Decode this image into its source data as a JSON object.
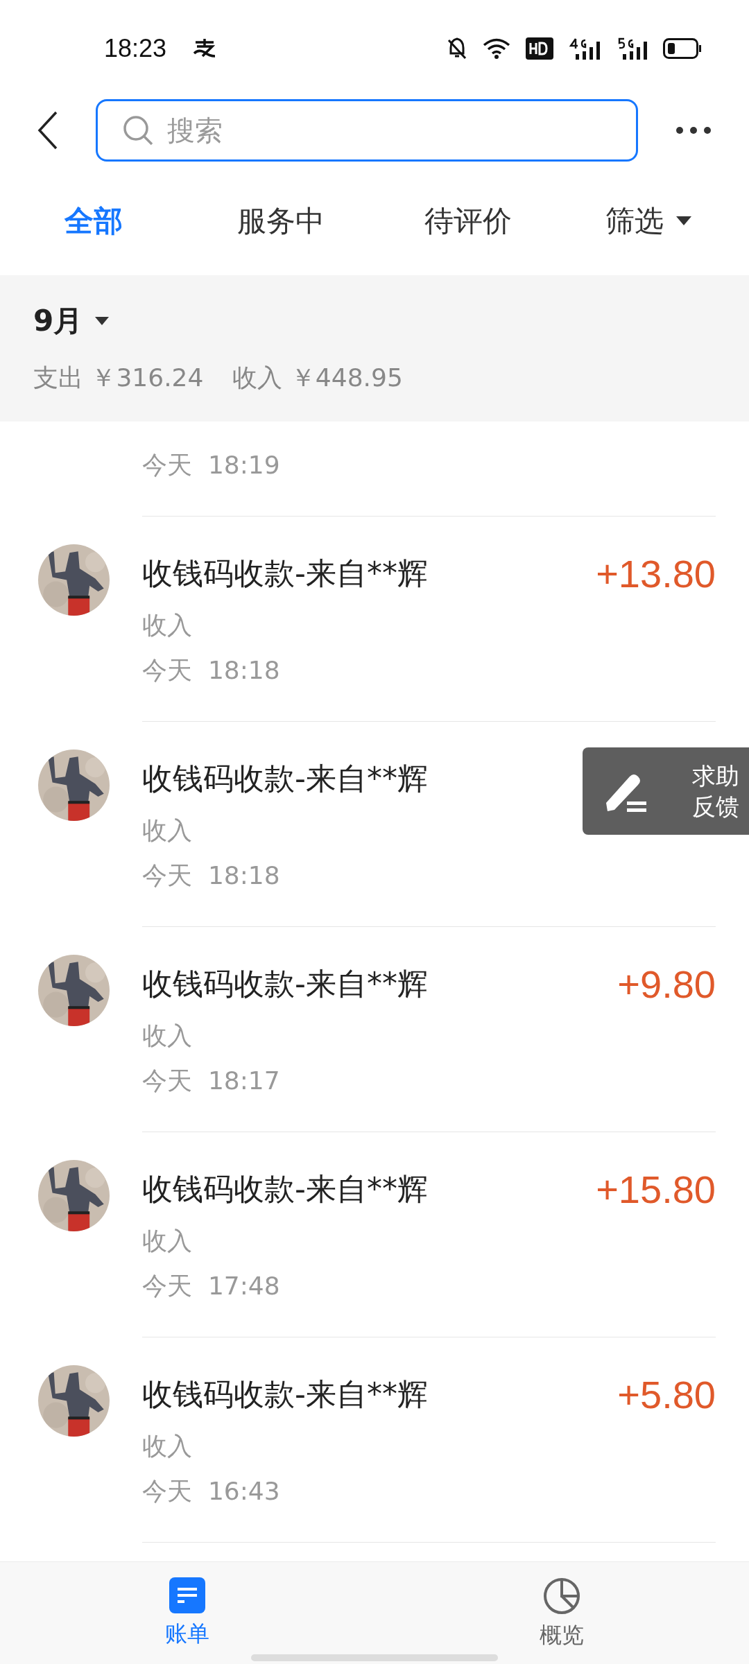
{
  "status_bar": {
    "time": "18:23"
  },
  "search": {
    "placeholder": "搜索"
  },
  "tabs": [
    {
      "label": "全部",
      "selected": true
    },
    {
      "label": "服务中",
      "selected": false
    },
    {
      "label": "待评价",
      "selected": false
    }
  ],
  "filter": {
    "label": "筛选"
  },
  "month": {
    "label": "9月",
    "expense": "支出 ￥316.24",
    "income": "收入 ￥448.95"
  },
  "transactions": [
    {
      "kind": "partial",
      "time": "今天  18:19"
    },
    {
      "kind": "full",
      "title": "收钱码收款-来自**辉",
      "amount": "+13.80",
      "type": "收入",
      "time": "今天  18:18"
    },
    {
      "kind": "full",
      "title": "收钱码收款-来自**辉",
      "type": "收入",
      "time": "今天  18:18"
    },
    {
      "kind": "full",
      "title": "收钱码收款-来自**辉",
      "amount": "+9.80",
      "type": "收入",
      "time": "今天  18:17"
    },
    {
      "kind": "full",
      "title": "收钱码收款-来自**辉",
      "amount": "+15.80",
      "type": "收入",
      "time": "今天  17:48"
    },
    {
      "kind": "full",
      "title": "收钱码收款-来自**辉",
      "amount": "+5.80",
      "type": "收入",
      "time": "今天  16:43"
    }
  ],
  "feedback": {
    "line1": "求助",
    "line2": "反馈"
  },
  "bottom_nav": [
    {
      "label": "账单",
      "selected": true
    },
    {
      "label": "概览",
      "selected": false
    }
  ]
}
